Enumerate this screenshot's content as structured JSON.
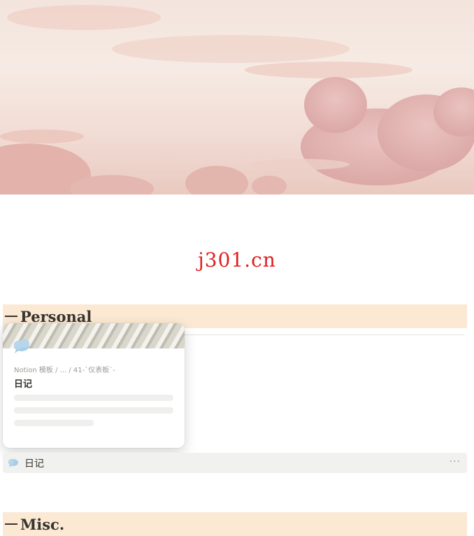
{
  "watermark": "j301.cn",
  "sections": {
    "personal": "Personal",
    "misc": "Misc."
  },
  "popup": {
    "breadcrumb": "Notion 模板 / ... / 41-`仪表板`-",
    "title": "日记",
    "icon": "cloud-icon"
  },
  "row": {
    "label": "日记",
    "icon": "cloud-icon",
    "more": "···"
  },
  "colors": {
    "section_bg": "#fbe9d4",
    "watermark": "#e02020",
    "cloud_icon": "#a9cde6"
  }
}
